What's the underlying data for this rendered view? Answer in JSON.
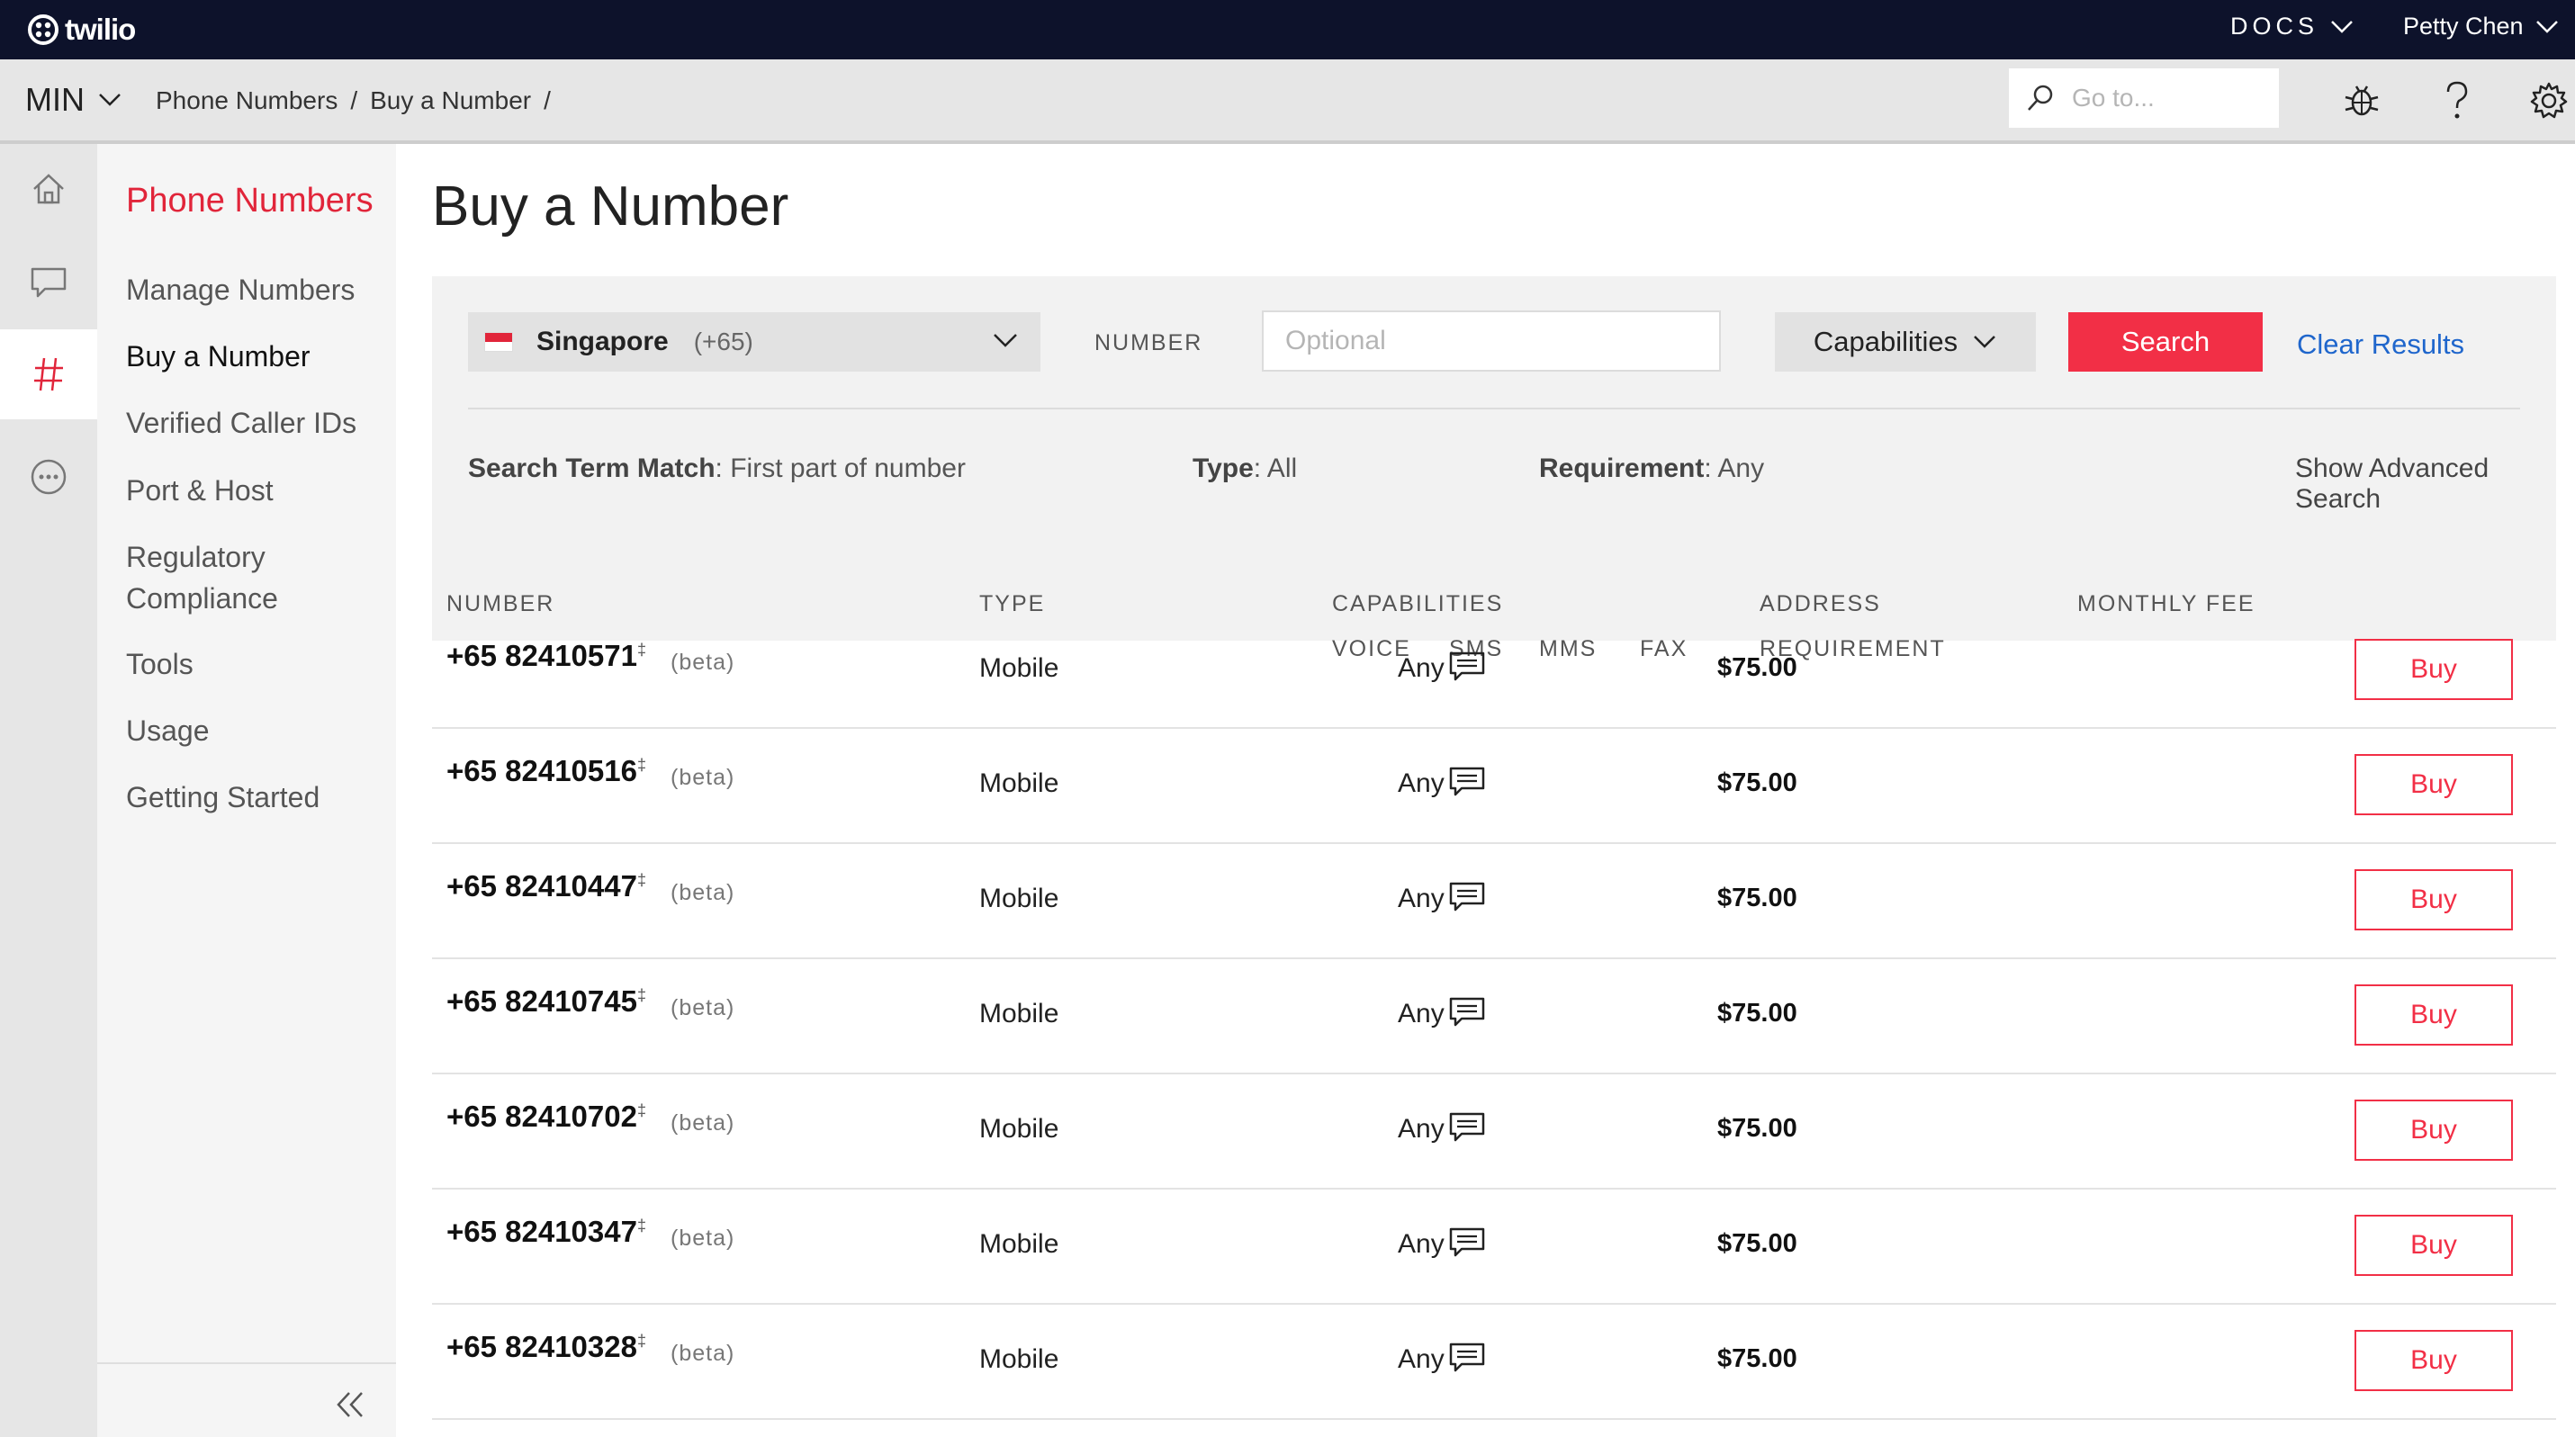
{
  "topbar": {
    "logo": "twilio",
    "docs": "DOCS",
    "user": "Petty Chen"
  },
  "subbar": {
    "account": "MIN",
    "breadcrumb": [
      "Phone Numbers",
      "/",
      "Buy a Number",
      "/"
    ],
    "goto_placeholder": "Go to..."
  },
  "rail": {
    "icons": [
      "home-icon",
      "chat-icon",
      "hash-icon",
      "more-icon"
    ],
    "active": "hash-icon"
  },
  "nav": {
    "title": "Phone Numbers",
    "items": [
      "Manage Numbers",
      "Buy a Number",
      "Verified Caller IDs",
      "Port & Host",
      "Regulatory Compliance",
      "Tools",
      "Usage",
      "Getting Started"
    ],
    "current": "Buy a Number"
  },
  "main": {
    "title": "Buy a Number",
    "search": {
      "country": "Singapore",
      "country_code": "(+65)",
      "number_label": "NUMBER",
      "number_placeholder": "Optional",
      "capabilities_label": "Capabilities",
      "search_label": "Search",
      "clear_label": "Clear Results"
    },
    "filters": {
      "match_label": "Search Term Match",
      "match_value": ": First part of number",
      "type_label": "Type",
      "type_value": ": All",
      "req_label": "Requirement",
      "req_value": ": Any",
      "advanced": "Show Advanced Search"
    },
    "table": {
      "headers": {
        "number": "NUMBER",
        "type": "TYPE",
        "capabilities": "CAPABILITIES",
        "voice": "VOICE",
        "sms": "SMS",
        "mms": "MMS",
        "fax": "FAX",
        "address": "ADDRESS",
        "requirement": "REQUIREMENT",
        "fee": "MONTHLY FEE"
      },
      "rows": [
        {
          "number": "+65 82410571",
          "mark": "‡",
          "beta": "(beta)",
          "type": "Mobile",
          "sms": true,
          "address": "Any",
          "fee": "$75.00",
          "buy": "Buy"
        },
        {
          "number": "+65 82410516",
          "mark": "‡",
          "beta": "(beta)",
          "type": "Mobile",
          "sms": true,
          "address": "Any",
          "fee": "$75.00",
          "buy": "Buy"
        },
        {
          "number": "+65 82410447",
          "mark": "‡",
          "beta": "(beta)",
          "type": "Mobile",
          "sms": true,
          "address": "Any",
          "fee": "$75.00",
          "buy": "Buy"
        },
        {
          "number": "+65 82410745",
          "mark": "‡",
          "beta": "(beta)",
          "type": "Mobile",
          "sms": true,
          "address": "Any",
          "fee": "$75.00",
          "buy": "Buy"
        },
        {
          "number": "+65 82410702",
          "mark": "‡",
          "beta": "(beta)",
          "type": "Mobile",
          "sms": true,
          "address": "Any",
          "fee": "$75.00",
          "buy": "Buy"
        },
        {
          "number": "+65 82410347",
          "mark": "‡",
          "beta": "(beta)",
          "type": "Mobile",
          "sms": true,
          "address": "Any",
          "fee": "$75.00",
          "buy": "Buy"
        },
        {
          "number": "+65 82410328",
          "mark": "‡",
          "beta": "(beta)",
          "type": "Mobile",
          "sms": true,
          "address": "Any",
          "fee": "$75.00",
          "buy": "Buy"
        }
      ]
    }
  },
  "colors": {
    "topbar": "#0d122b",
    "accent_red": "#f22f46",
    "nav_title": "#e1253a",
    "link_blue": "#1f66cc"
  }
}
